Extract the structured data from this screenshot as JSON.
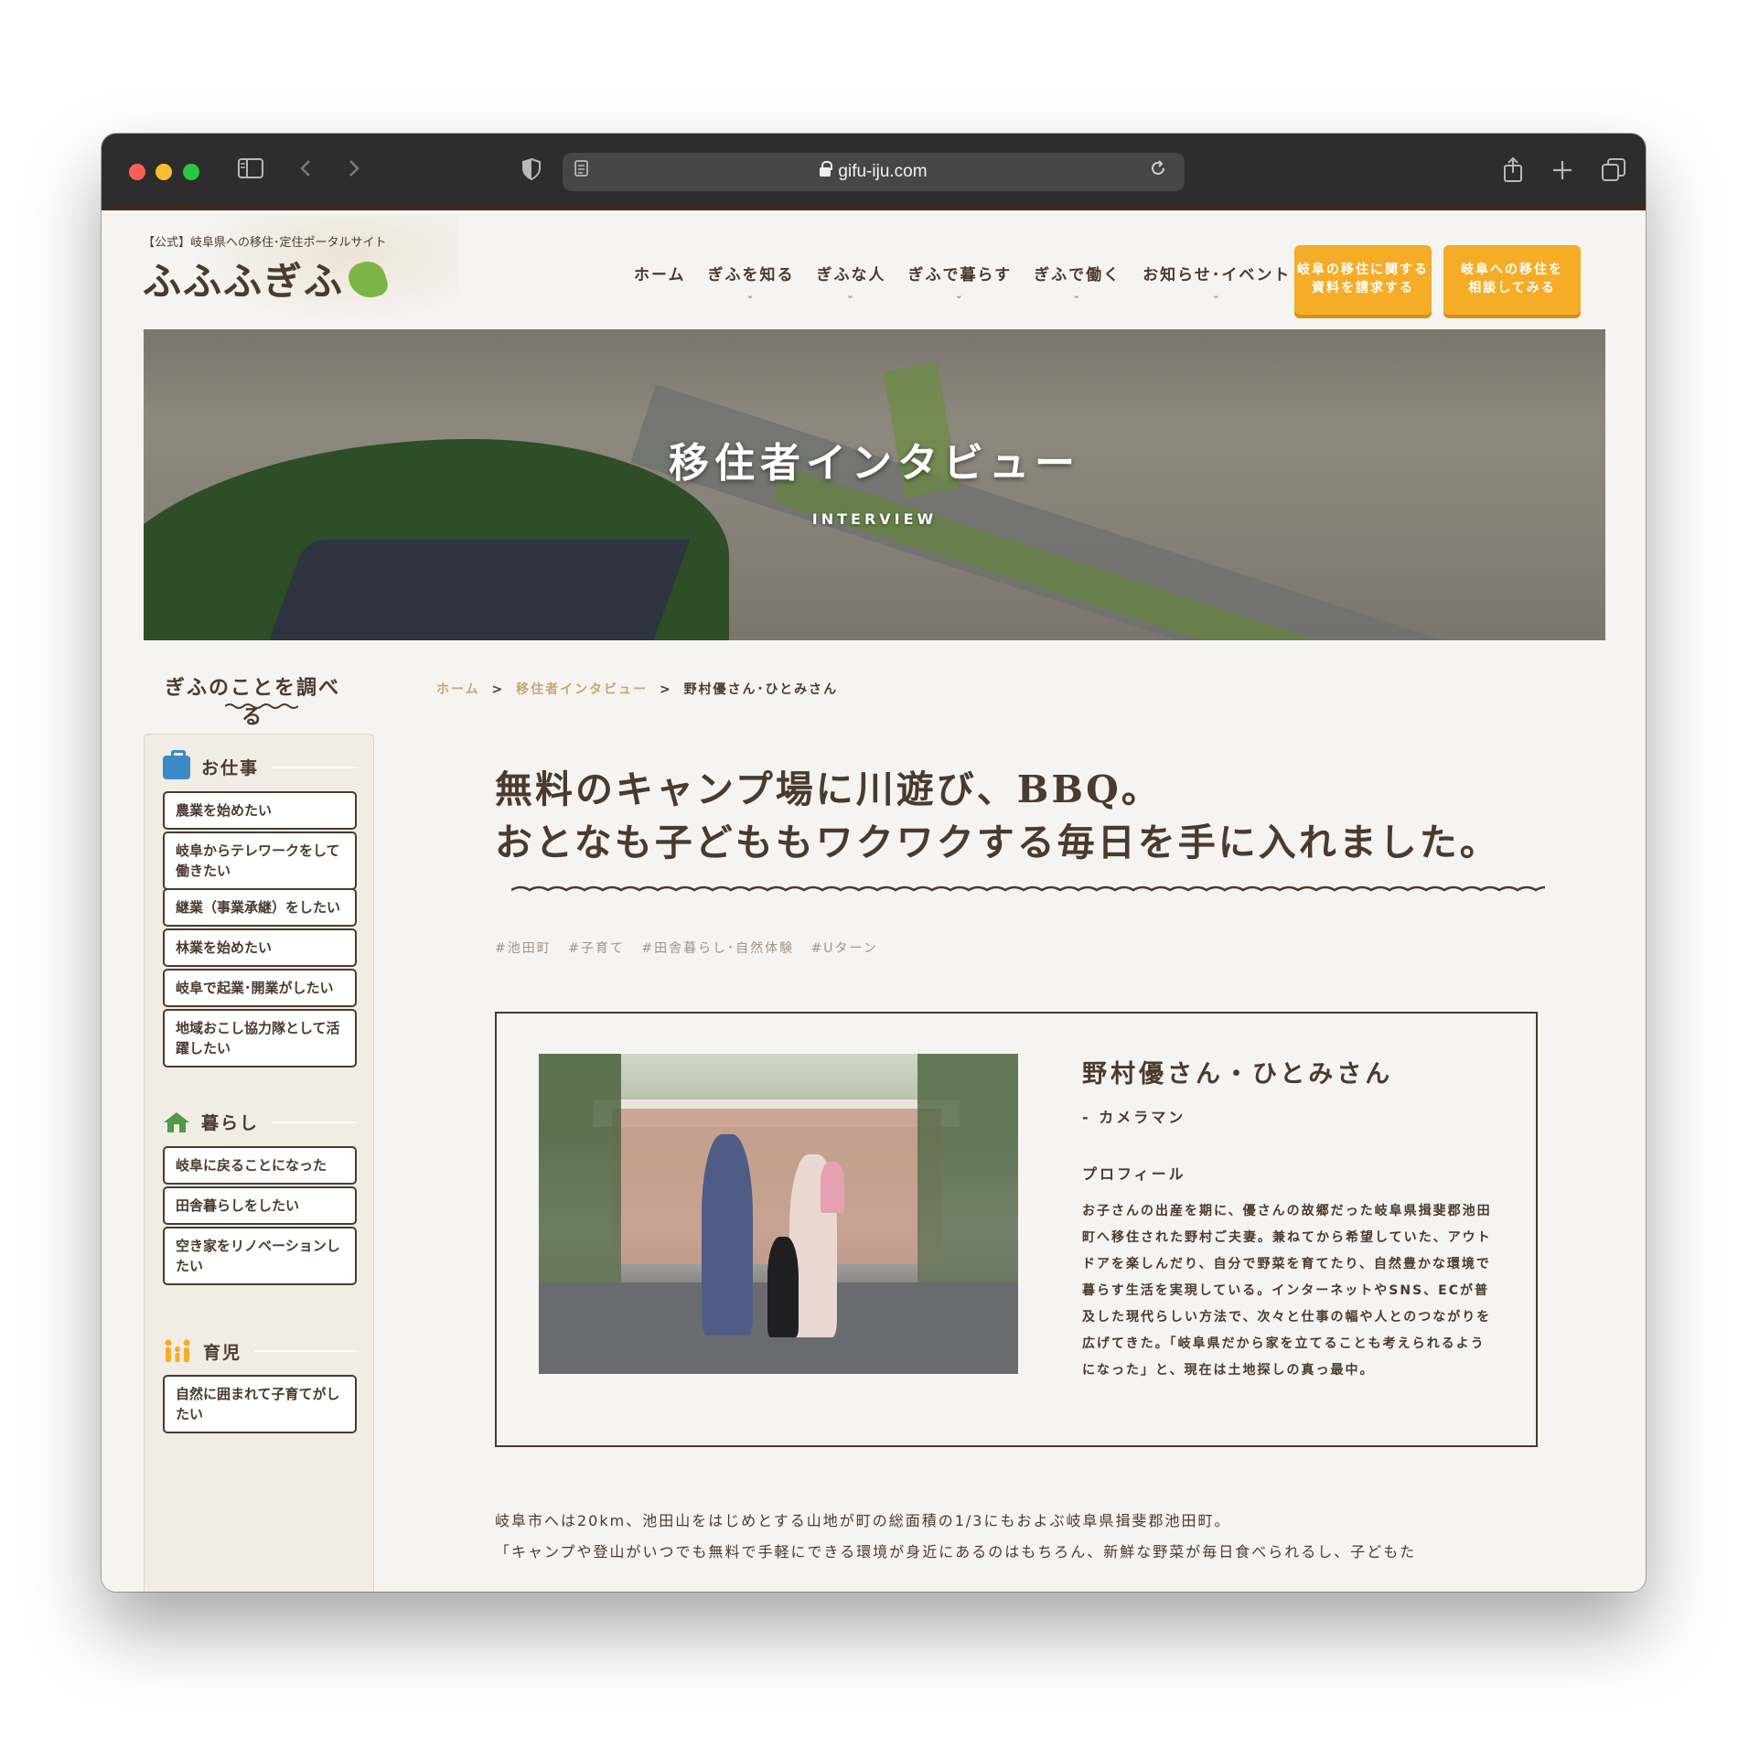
{
  "browser": {
    "url": "gifu-iju.com"
  },
  "header": {
    "tagline": "【公式】岐阜県への移住･定住ポータルサイト",
    "logo": "ふふふぎふ",
    "nav": [
      {
        "label": "ホーム",
        "has_dropdown": false
      },
      {
        "label": "ぎふを知る",
        "has_dropdown": true
      },
      {
        "label": "ぎふな人",
        "has_dropdown": true
      },
      {
        "label": "ぎふで暮らす",
        "has_dropdown": true
      },
      {
        "label": "ぎふで働く",
        "has_dropdown": true
      },
      {
        "label": "お知らせ･イベント",
        "has_dropdown": true
      }
    ],
    "cta1_line1": "岐阜の移住に関する",
    "cta1_line2": "資料を請求する",
    "cta2_line1": "岐阜への移住を",
    "cta2_line2": "相談してみる",
    "accent_color": "#f5ad28"
  },
  "hero": {
    "title": "移住者インタビュー",
    "subtitle": "INTERVIEW"
  },
  "sidebar": {
    "title": "ぎふのことを調べる",
    "sections": [
      {
        "label": "お仕事",
        "icon": "briefcase-icon",
        "items": [
          "農業を始めたい",
          "岐阜からテレワークをして働きたい",
          "継業（事業承継）をしたい",
          "林業を始めたい",
          "岐阜で起業･開業がしたい",
          "地域おこし協力隊として活躍したい"
        ]
      },
      {
        "label": "暮らし",
        "icon": "house-icon",
        "items": [
          "岐阜に戻ることになった",
          "田舎暮らしをしたい",
          "空き家をリノベーションしたい"
        ]
      },
      {
        "label": "育児",
        "icon": "family-icon",
        "items": [
          "自然に囲まれて子育てがしたい"
        ]
      }
    ]
  },
  "breadcrumb": {
    "home": "ホーム",
    "section": "移住者インタビュー",
    "current": "野村優さん･ひとみさん",
    "separator": ">"
  },
  "article": {
    "title_line1": "無料のキャンプ場に川遊び、BBQ。",
    "title_line2": "おとなも子どももワクワクする毎日を手に入れました。",
    "tags": [
      "#池田町",
      "#子育て",
      "#田舎暮らし･自然体験",
      "#Uターン"
    ],
    "profile": {
      "name": "野村優さん・ひとみさん",
      "role": "- カメラマン",
      "label": "プロフィール",
      "text": "お子さんの出産を期に、優さんの故郷だった岐阜県揖斐郡池田町へ移住された野村ご夫妻。兼ねてから希望していた、アウトドアを楽しんだり、自分で野菜を育てたり、自然豊かな環境で暮らす生活を実現している。インターネットやSNS、ECが普及した現代らしい方法で、次々と仕事の幅や人とのつながりを広げてきた。「岐阜県だから家を立てることも考えられるようになった」と、現在は土地探しの真っ最中。"
    },
    "body_line1": "岐阜市へは20km、池田山をはじめとする山地が町の総面積の1/3にもおよぶ岐阜県揖斐郡池田町。",
    "body_line2": "「キャンプや登山がいつでも無料で手軽にできる環境が身近にあるのはもちろん、新鮮な野菜が毎日食べられるし、子どもた"
  }
}
